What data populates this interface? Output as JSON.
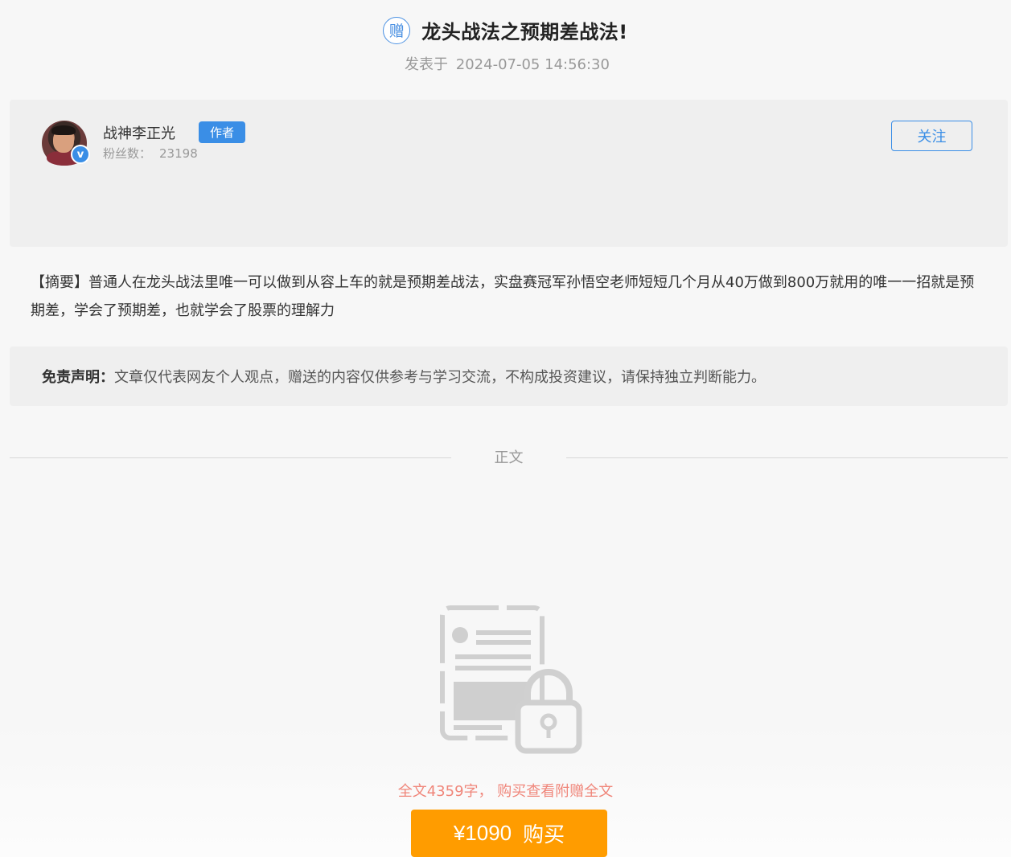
{
  "article": {
    "gift_badge": "赠",
    "title": "龙头战法之预期差战法!",
    "published_prefix": "发表于",
    "published_at": "2024-07-05 14:56:30"
  },
  "author": {
    "name": "战神李正光",
    "tag": "作者",
    "fans_label": "粉丝数：",
    "fans_count": "23198",
    "verified_mark": "v",
    "follow_label": "关注"
  },
  "summary": {
    "text": "【摘要】普通人在龙头战法里唯一可以做到从容上车的就是预期差战法，实盘赛冠军孙悟空老师短短几个月从40万做到800万就用的唯一一招就是预期差，学会了预期差，也就学会了股票的理解力"
  },
  "disclaimer": {
    "label": "免责声明：",
    "text": "文章仅代表网友个人观点，赠送的内容仅供参考与学习交流，不构成投资建议，请保持独立判断能力。"
  },
  "content": {
    "divider_label": "正文",
    "locked_icon": "locked-document-icon",
    "word_count_text": "全文4359字， 购买查看附赠全文"
  },
  "purchase": {
    "price": "¥1090",
    "label": "购买"
  },
  "colors": {
    "accent": "#3a8ee6",
    "buy_button": "#ff9c00",
    "notice_text": "#f0867a"
  }
}
